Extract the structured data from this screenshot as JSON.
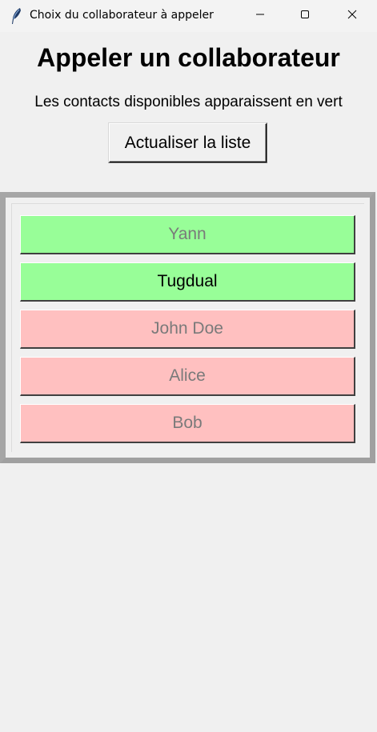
{
  "window": {
    "title": "Choix du collaborateur à appeler"
  },
  "titlebar_icons": {
    "app": "feather-icon",
    "minimize": "minimize-icon",
    "maximize": "maximize-icon",
    "close": "close-icon"
  },
  "header": {
    "title": "Appeler un collaborateur",
    "subtitle": "Les contacts disponibles apparaissent en vert",
    "refresh_label": "Actualiser la liste"
  },
  "colors": {
    "available": "#98fe98",
    "unavailable": "#ffc0c0",
    "frame": "#a0a0a0",
    "background": "#f0f0f0"
  },
  "contacts": [
    {
      "name": "Yann",
      "status": "available",
      "enabled": false
    },
    {
      "name": "Tugdual",
      "status": "available",
      "enabled": true
    },
    {
      "name": "John Doe",
      "status": "unavailable",
      "enabled": false
    },
    {
      "name": "Alice",
      "status": "unavailable",
      "enabled": false
    },
    {
      "name": "Bob",
      "status": "unavailable",
      "enabled": false
    }
  ]
}
